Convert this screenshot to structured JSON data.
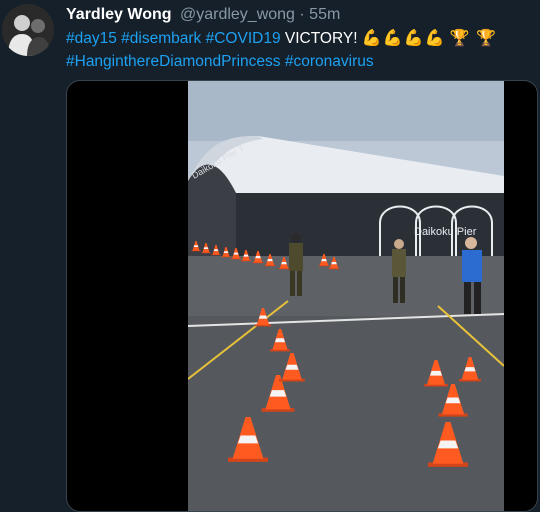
{
  "tweet": {
    "display_name": "Yardley Wong",
    "handle": "@yardley_wong",
    "separator": "·",
    "time": "55m",
    "text_parts": [
      {
        "kind": "hashtag",
        "text": "#day15"
      },
      {
        "kind": "text",
        "text": " "
      },
      {
        "kind": "hashtag",
        "text": "#disembark"
      },
      {
        "kind": "text",
        "text": " "
      },
      {
        "kind": "hashtag",
        "text": "#COVID19"
      },
      {
        "kind": "text",
        "text": " VICTORY! "
      },
      {
        "kind": "emoji",
        "icon": "flexed-biceps-icon",
        "text": "💪💪💪💪"
      },
      {
        "kind": "text",
        "text": " "
      },
      {
        "kind": "emoji",
        "icon": "trophy-icon",
        "text": "🏆 🏆"
      },
      {
        "kind": "break"
      },
      {
        "kind": "hashtag",
        "text": "#HanginthereDiamondPrincess"
      },
      {
        "kind": "text",
        "text": " "
      },
      {
        "kind": "hashtag",
        "text": "#coronavirus"
      }
    ]
  },
  "video": {
    "sign_text": "Daikoku Pier",
    "building_text": "Daikoku Pier T"
  },
  "colors": {
    "background": "#15202b",
    "link": "#1da1f2",
    "secondary": "#8899a6",
    "border": "#38444d",
    "cone": "#ff5a1f"
  }
}
